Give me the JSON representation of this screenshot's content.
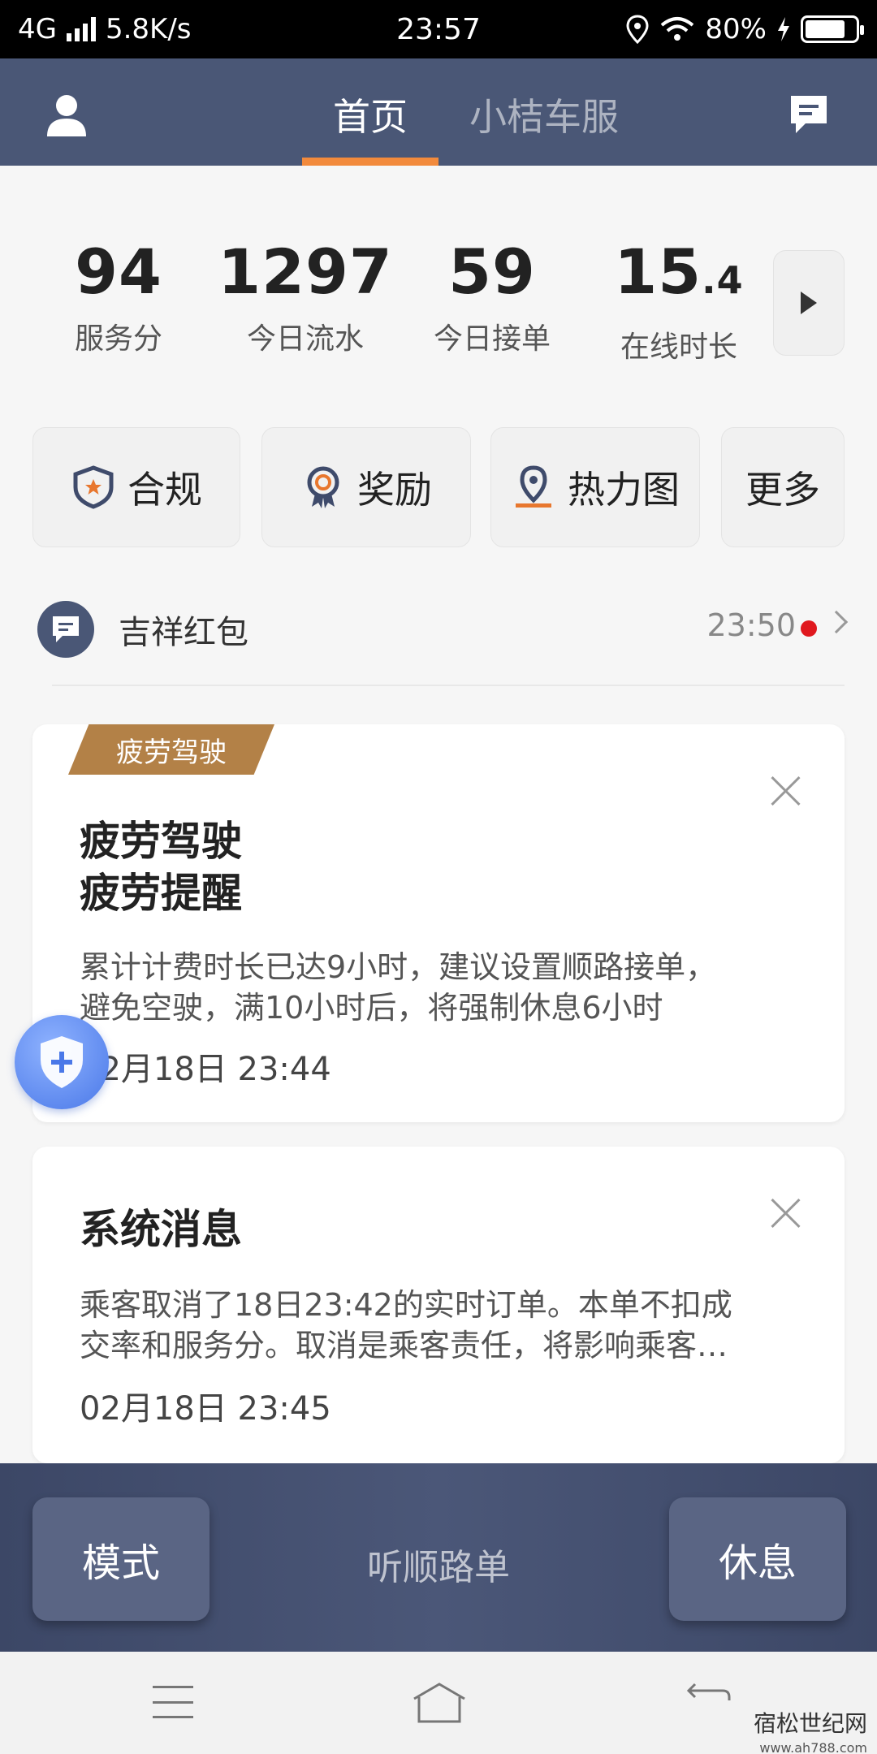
{
  "status_bar": {
    "network": "4G",
    "speed": "5.8K/s",
    "time": "23:57",
    "battery": "80%",
    "battery_level": 0.8
  },
  "header": {
    "tabs": [
      {
        "label": "首页",
        "active": true
      },
      {
        "label": "小桔车服",
        "active": false
      }
    ],
    "accent_color": "#f28a3c",
    "bg_color": "#4a5776"
  },
  "stats": [
    {
      "value": "94",
      "label": "服务分"
    },
    {
      "value": "1297",
      "label": "今日流水"
    },
    {
      "value": "59",
      "label": "今日接单"
    },
    {
      "value_main": "15",
      "value_decimal": ".4",
      "label": "在线时长"
    }
  ],
  "shortcuts": [
    {
      "label": "合规",
      "icon": "shield-star-icon"
    },
    {
      "label": "奖励",
      "icon": "medal-icon"
    },
    {
      "label": "热力图",
      "icon": "map-pin-icon"
    },
    {
      "label": "更多"
    }
  ],
  "notice": {
    "title": "吉祥红包",
    "time": "23:50"
  },
  "cards": [
    {
      "tag": "疲劳驾驶",
      "title_line1": "疲劳驾驶",
      "title_line2": "疲劳提醒",
      "body_line1": "累计计费时长已达9小时，建议设置顺路接单，",
      "body_line2": "避免空驶，满10小时后，将强制休息6小时",
      "date": "02月18日 23:44"
    },
    {
      "title": "系统消息",
      "body_line1": "乘客取消了18日23:42的实时订单。本单不扣成",
      "body_line2": "交率和服务分。取消是乘客责任，将影响乘客…",
      "date": "02月18日 23:45"
    }
  ],
  "action_bar": {
    "mode": "模式",
    "center": "听顺路单",
    "rest": "休息"
  },
  "watermark": {
    "site": "宿松世纪网",
    "url": "www.ah788.com"
  }
}
